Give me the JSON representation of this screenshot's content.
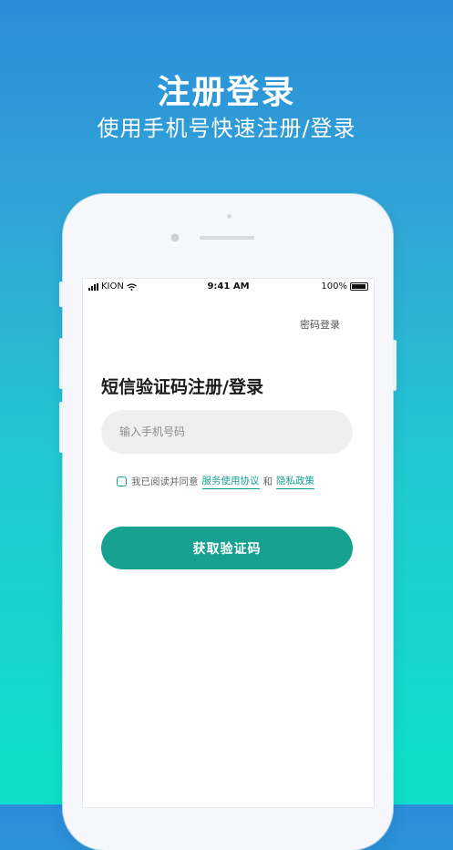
{
  "header": {
    "title": "注册登录",
    "subtitle": "使用手机号快速注册/登录"
  },
  "status_bar": {
    "carrier": "KION",
    "time": "9:41 AM",
    "battery": "100%"
  },
  "login": {
    "switch_link": "密码登录",
    "title": "短信验证码注册/登录",
    "phone_placeholder": "输入手机号码",
    "agree_prefix": "我已阅读并同意",
    "terms_link": "服务使用协议",
    "and": "和",
    "privacy_link": "隐私政策",
    "agree_checked": false,
    "submit_label": "获取验证码"
  },
  "colors": {
    "accent": "#16a190",
    "bg_top": "#2b8ddb",
    "bg_bottom": "#0edfc9"
  }
}
